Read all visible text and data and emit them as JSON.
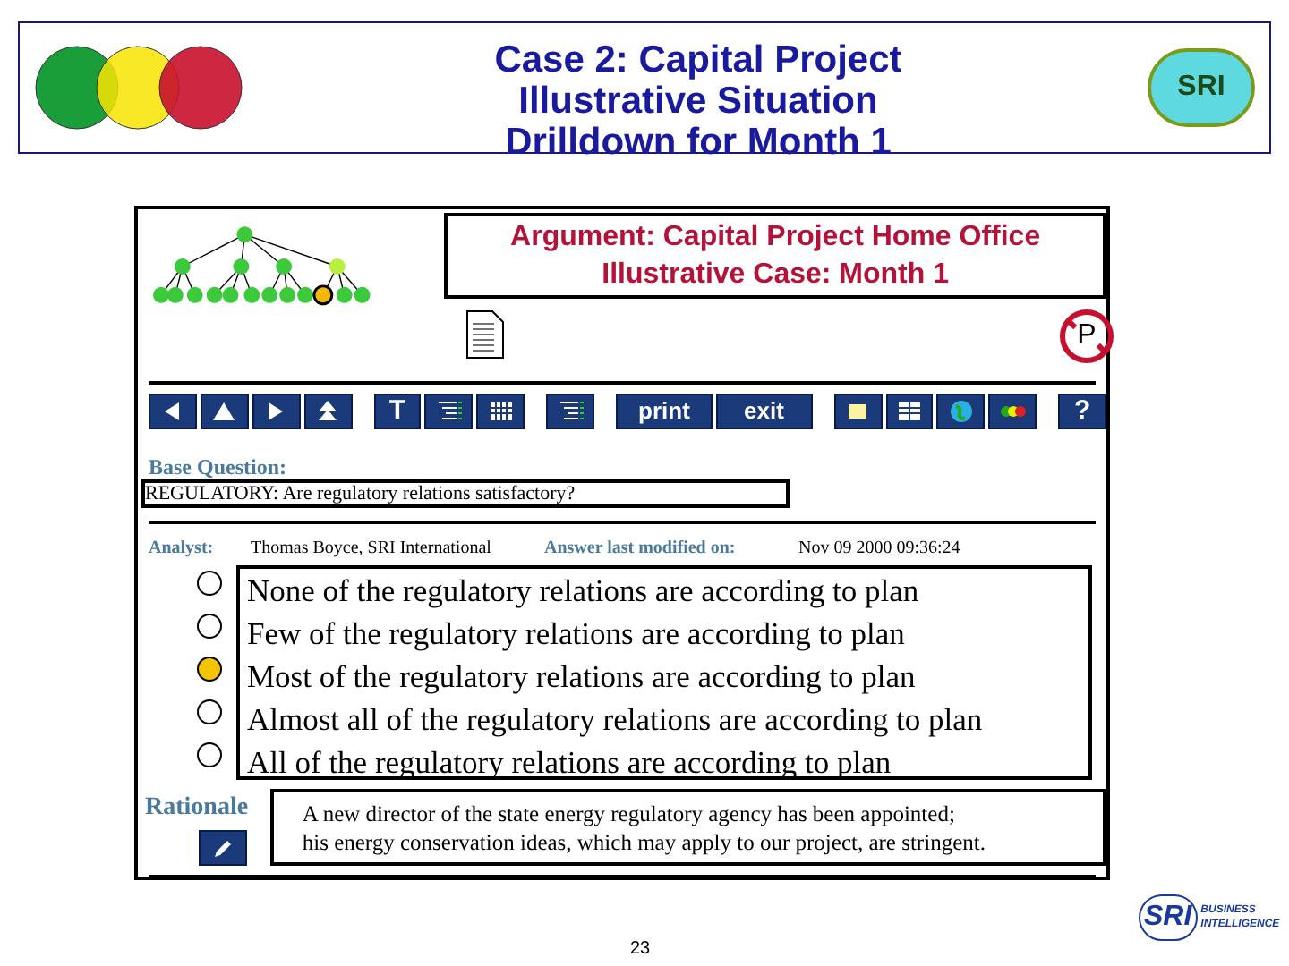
{
  "header": {
    "title_lines": [
      "Case 2: Capital Project",
      "Illustrative Situation",
      "Drilldown for Month 1"
    ],
    "badge_text": "SRI"
  },
  "argument": {
    "title_lines": [
      "Argument: Capital Project Home Office",
      "Illustrative Case: Month 1"
    ],
    "symbol": "P"
  },
  "toolbar": [
    {
      "kind": "left"
    },
    {
      "kind": "up"
    },
    {
      "kind": "right"
    },
    {
      "kind": "top"
    },
    {
      "kind": "letter",
      "label": "T"
    },
    {
      "kind": "list"
    },
    {
      "kind": "grid"
    },
    {
      "kind": "list"
    },
    {
      "kind": "text",
      "label": "print"
    },
    {
      "kind": "text",
      "label": "exit"
    },
    {
      "kind": "note"
    },
    {
      "kind": "columns"
    },
    {
      "kind": "globe"
    },
    {
      "kind": "lights"
    },
    {
      "kind": "letter",
      "label": "?"
    }
  ],
  "base_question": {
    "label": "Base Question:",
    "value": "REGULATORY: Are regulatory relations satisfactory?"
  },
  "analyst": {
    "label": "Analyst:",
    "value": "Thomas Boyce, SRI International",
    "modified_label": "Answer last modified on:",
    "modified_value": "Nov 09 2000 09:36:24"
  },
  "options": [
    {
      "label": "None of the regulatory relations are according to plan",
      "selected": false
    },
    {
      "label": "Few of the regulatory relations are according to plan",
      "selected": false
    },
    {
      "label": "Most of the regulatory relations are according to plan",
      "selected": true
    },
    {
      "label": "Almost all of the regulatory relations are according to plan",
      "selected": false
    },
    {
      "label": "All of the regulatory relations are according to plan",
      "selected": false
    }
  ],
  "rationale": {
    "label": "Rationale",
    "lines": [
      "A new director of the state energy regulatory agency has been appointed;",
      "his energy conservation ideas, which may apply to our project, are stringent."
    ]
  },
  "page_number": "23",
  "footer_logo": {
    "initials": "SRI",
    "lines": [
      "BUSINESS",
      "INTELLIGENCE"
    ]
  }
}
